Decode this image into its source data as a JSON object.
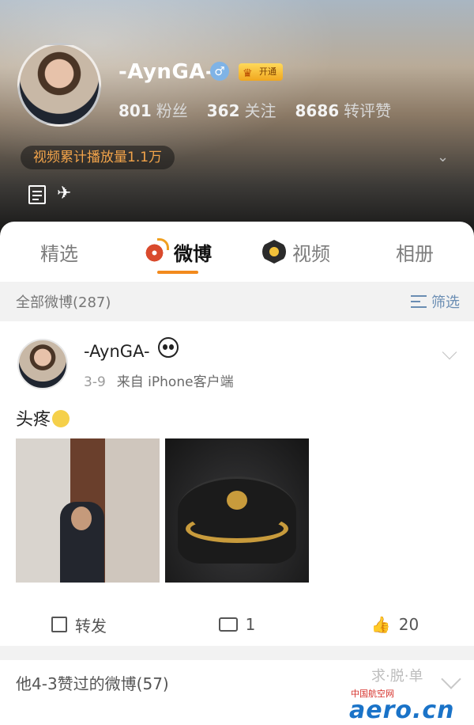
{
  "profile": {
    "username": "-AynGA-",
    "gender_symbol": "♂",
    "vip_label": "开通",
    "stats": [
      {
        "value": "801",
        "label": "粉丝"
      },
      {
        "value": "362",
        "label": "关注"
      },
      {
        "value": "8686",
        "label": "转评赞"
      }
    ],
    "views_text": "视频累计播放量1.1万"
  },
  "tabs": [
    {
      "label": "精选"
    },
    {
      "label": "微博"
    },
    {
      "label": "视频"
    },
    {
      "label": "相册"
    }
  ],
  "filter_bar": {
    "all_label": "全部微博(287)",
    "filter_label": "筛选"
  },
  "post": {
    "author": "-AynGA-",
    "date": "3-9",
    "source": "来自 iPhone客户端",
    "text": "头疼",
    "actions": {
      "repost_label": "转发",
      "comment_count": "1",
      "like_count": "20"
    }
  },
  "liked_section": {
    "title": "他4-3赞过的微博(57)"
  },
  "watermark": {
    "overlay": "求·脱·单",
    "site_cn": "中国航空网",
    "site_en": "aero.cn"
  },
  "colors": {
    "accent_orange": "#f28a1d",
    "link_blue": "#6a8db3"
  }
}
